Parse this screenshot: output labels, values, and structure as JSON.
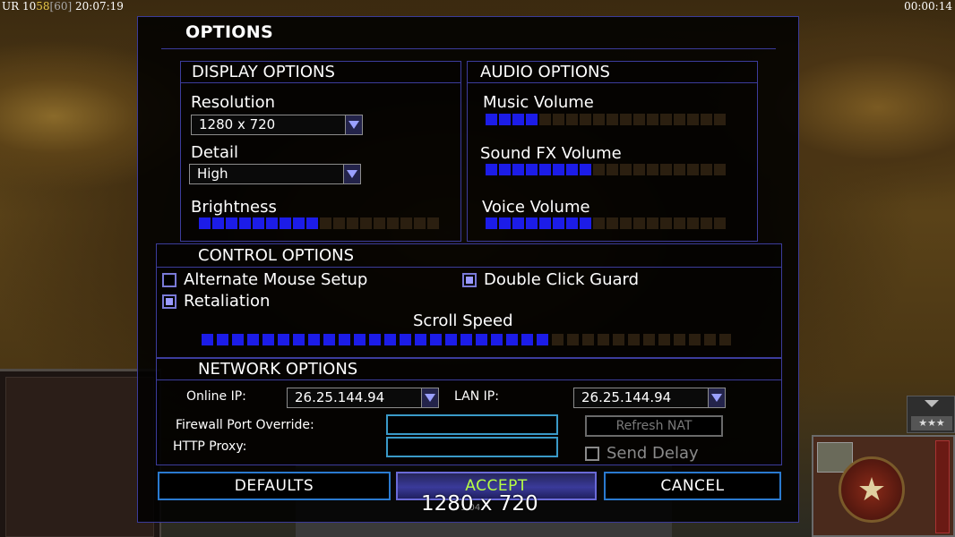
{
  "hud": {
    "left_prefix": "UR",
    "left_num": "10",
    "left_yellow": "58",
    "left_grey": "[60]",
    "left_time": "20:07:19",
    "right_time": "00:00:14"
  },
  "dialog": {
    "title": "OPTIONS"
  },
  "display": {
    "heading": "DISPLAY OPTIONS",
    "resolution_label": "Resolution",
    "resolution_value": "1280 x 720",
    "detail_label": "Detail",
    "detail_value": "High",
    "brightness_label": "Brightness",
    "brightness_level": 0.52
  },
  "audio": {
    "heading": "AUDIO OPTIONS",
    "music_label": "Music Volume",
    "music_level": 0.22,
    "sfx_label": "Sound FX Volume",
    "sfx_level": 0.44,
    "voice_label": "Voice Volume",
    "voice_level": 0.44
  },
  "control": {
    "heading": "CONTROL OPTIONS",
    "alt_mouse_label": "Alternate Mouse Setup",
    "alt_mouse_checked": false,
    "double_click_label": "Double Click Guard",
    "double_click_checked": true,
    "retaliation_label": "Retaliation",
    "retaliation_checked": true,
    "scroll_label": "Scroll Speed",
    "scroll_level": 0.66
  },
  "network": {
    "heading": "NETWORK OPTIONS",
    "online_ip_label": "Online IP:",
    "online_ip_value": "26.25.144.94",
    "lan_ip_label": "LAN IP:",
    "lan_ip_value": "26.25.144.94",
    "firewall_label": "Firewall Port Override:",
    "firewall_value": "",
    "proxy_label": "HTTP Proxy:",
    "proxy_value": "",
    "refresh_label": "Refresh NAT",
    "send_delay_label": "Send Delay",
    "send_delay_checked": false
  },
  "buttons": {
    "defaults": "DEFAULTS",
    "accept": "ACCEPT",
    "cancel": "CANCEL"
  },
  "overlay": {
    "text": "1280 x 720",
    "under_text": "1.04"
  },
  "colors": {
    "slider_on": "#1c1ce8",
    "slider_off": "#2b1f10",
    "accent_border": "#3c3c9c",
    "accept_text": "#b6ff44"
  }
}
